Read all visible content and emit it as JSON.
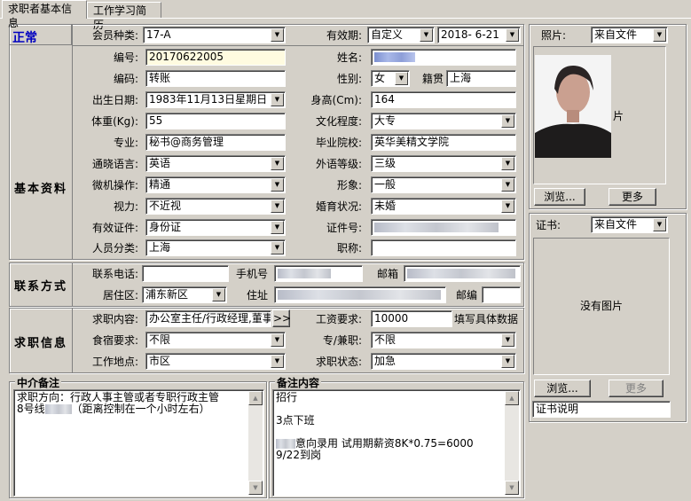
{
  "tabs": [
    "求职者基本信息",
    "工作学习简历"
  ],
  "status": "正常",
  "member_type_label": "会员种类:",
  "member_type": "17-A",
  "validity_label": "有效期:",
  "validity_mode": "自定义",
  "validity_date": "2018- 6-21",
  "photo_label": "照片:",
  "photo_source": "来自文件",
  "photo_suffix": "片",
  "photo_browse": "浏览...",
  "photo_more": "更多",
  "basic_section": "基本资料",
  "fields": {
    "number_label": "编号:",
    "number": "20170622005",
    "name_label": "姓名:",
    "code_label": "编码:",
    "code": "转账",
    "gender_label": "性别:",
    "gender": "女",
    "native_label": "籍贯",
    "native": "上海",
    "birth_label": "出生日期:",
    "birth": "1983年11月13日星期日",
    "height_label": "身高(Cm):",
    "height": "164",
    "weight_label": "体重(Kg):",
    "weight": "55",
    "education_label": "文化程度:",
    "education": "大专",
    "major_label": "专业:",
    "major": "秘书@商务管理",
    "school_label": "毕业院校:",
    "school": "英华美精文学院",
    "language_label": "通晓语言:",
    "language": "英语",
    "lang_level_label": "外语等级:",
    "lang_level": "三级",
    "computer_label": "微机操作:",
    "computer": "精通",
    "appearance_label": "形象:",
    "appearance": "一般",
    "vision_label": "视力:",
    "vision": "不近视",
    "marital_label": "婚育状况:",
    "marital": "未婚",
    "id_type_label": "有效证件:",
    "id_type": "身份证",
    "id_no_label": "证件号:",
    "category_label": "人员分类:",
    "category": "上海",
    "title_label": "职称:"
  },
  "contact_section": "联系方式",
  "contact": {
    "phone_label": "联系电话:",
    "mobile_label": "手机号",
    "email_label": "邮箱",
    "district_label": "居住区:",
    "district": "浦东新区",
    "address_label": "住址",
    "zip_label": "邮编"
  },
  "job_section": "求职信息",
  "job": {
    "content_label": "求职内容:",
    "content": "办公室主任/行政经理,董事",
    "more_btn": ">>",
    "salary_label": "工资要求:",
    "salary": "10000",
    "salary_hint": "填写具体数据",
    "board_label": "食宿要求:",
    "board": "不限",
    "parttime_label": "专/兼职:",
    "parttime": "不限",
    "location_label": "工作地点:",
    "location": "市区",
    "state_label": "求职状态:",
    "state": "加急"
  },
  "cert_label": "证书:",
  "cert_source": "来自文件",
  "cert_nopic": "没有图片",
  "cert_browse": "浏览...",
  "cert_more": "更多",
  "cert_desc": "证书说明",
  "agent_note_title": "中介备注",
  "agent_note_lines": [
    "求职方向：行政人事主管或者专职行政主管",
    "8号线",
    "（距离控制在一个小时左右）"
  ],
  "remark_title": "备注内容",
  "remark_lines": [
    "招行",
    "",
    "3点下班",
    "",
    "意向录用 试用期薪资8K*0.75=6000",
    "9/22到岗"
  ]
}
